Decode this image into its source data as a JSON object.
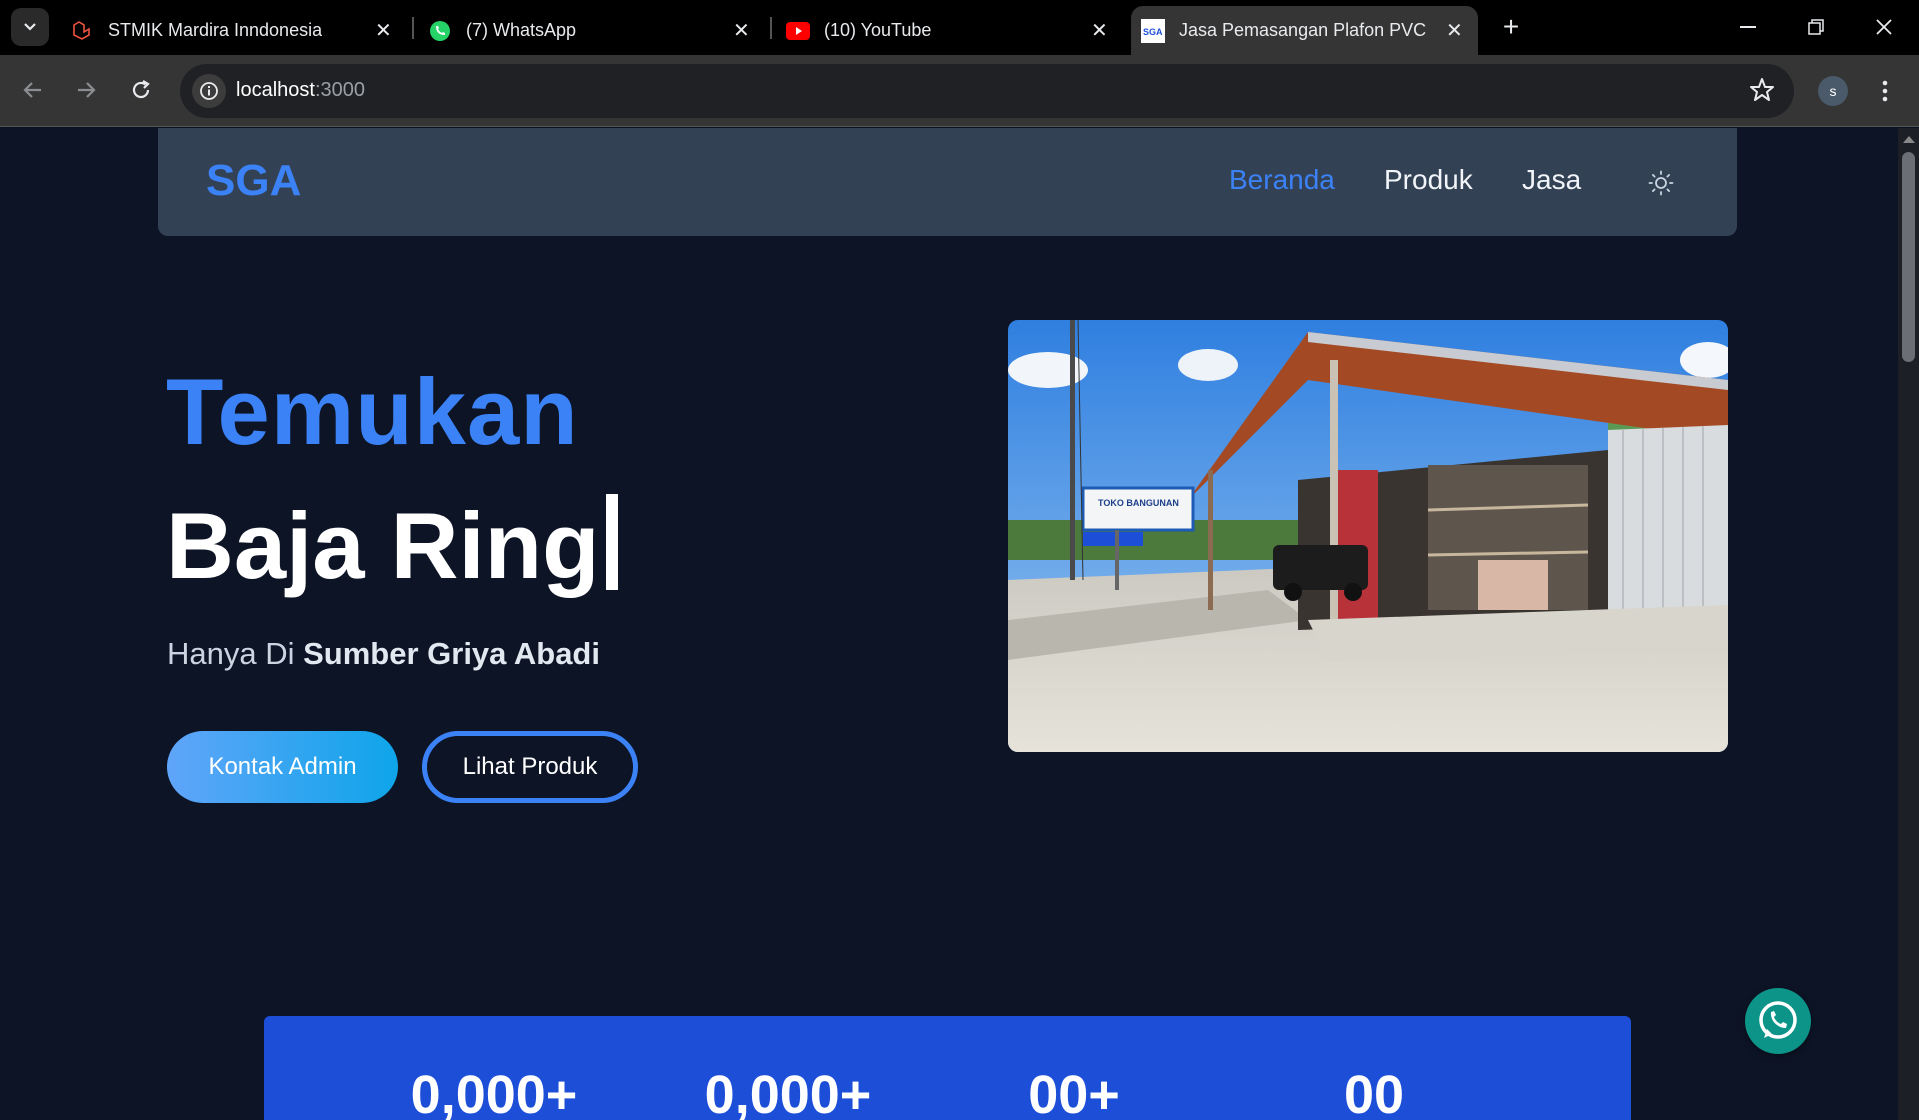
{
  "browser": {
    "tabs": [
      {
        "title": "STMIK Mardira Inndonesia",
        "icon": "laravel-icon"
      },
      {
        "title": "(7) WhatsApp",
        "icon": "whatsapp-icon"
      },
      {
        "title": "(10) YouTube",
        "icon": "youtube-icon"
      },
      {
        "title": "Jasa Pemasangan Plafon PVC &",
        "icon": "sga-favicon",
        "active": true
      }
    ],
    "url_host": "localhost",
    "url_port": ":3000",
    "profile_initial": "s"
  },
  "site": {
    "logo": "SGA",
    "nav": [
      {
        "label": "Beranda",
        "active": true
      },
      {
        "label": "Produk"
      },
      {
        "label": "Jasa"
      }
    ],
    "theme_icon": "sun-icon"
  },
  "hero": {
    "line1": "Temukan",
    "line2": "Baja Ring",
    "sub_prefix": "Hanya Di ",
    "sub_bold": "Sumber Griya Abadi",
    "btn_primary": "Kontak Admin",
    "btn_secondary": "Lihat Produk",
    "image_label": "TOKO BANGUNAN"
  },
  "stats": [
    "0,000+",
    "0,000+",
    "00+",
    "00"
  ],
  "colors": {
    "accent": "#3b82f6",
    "page_bg": "#0d1426",
    "nav_bg": "#334155",
    "stats_bg": "#1d4ed8",
    "whatsapp_btn": "#0d9488"
  }
}
